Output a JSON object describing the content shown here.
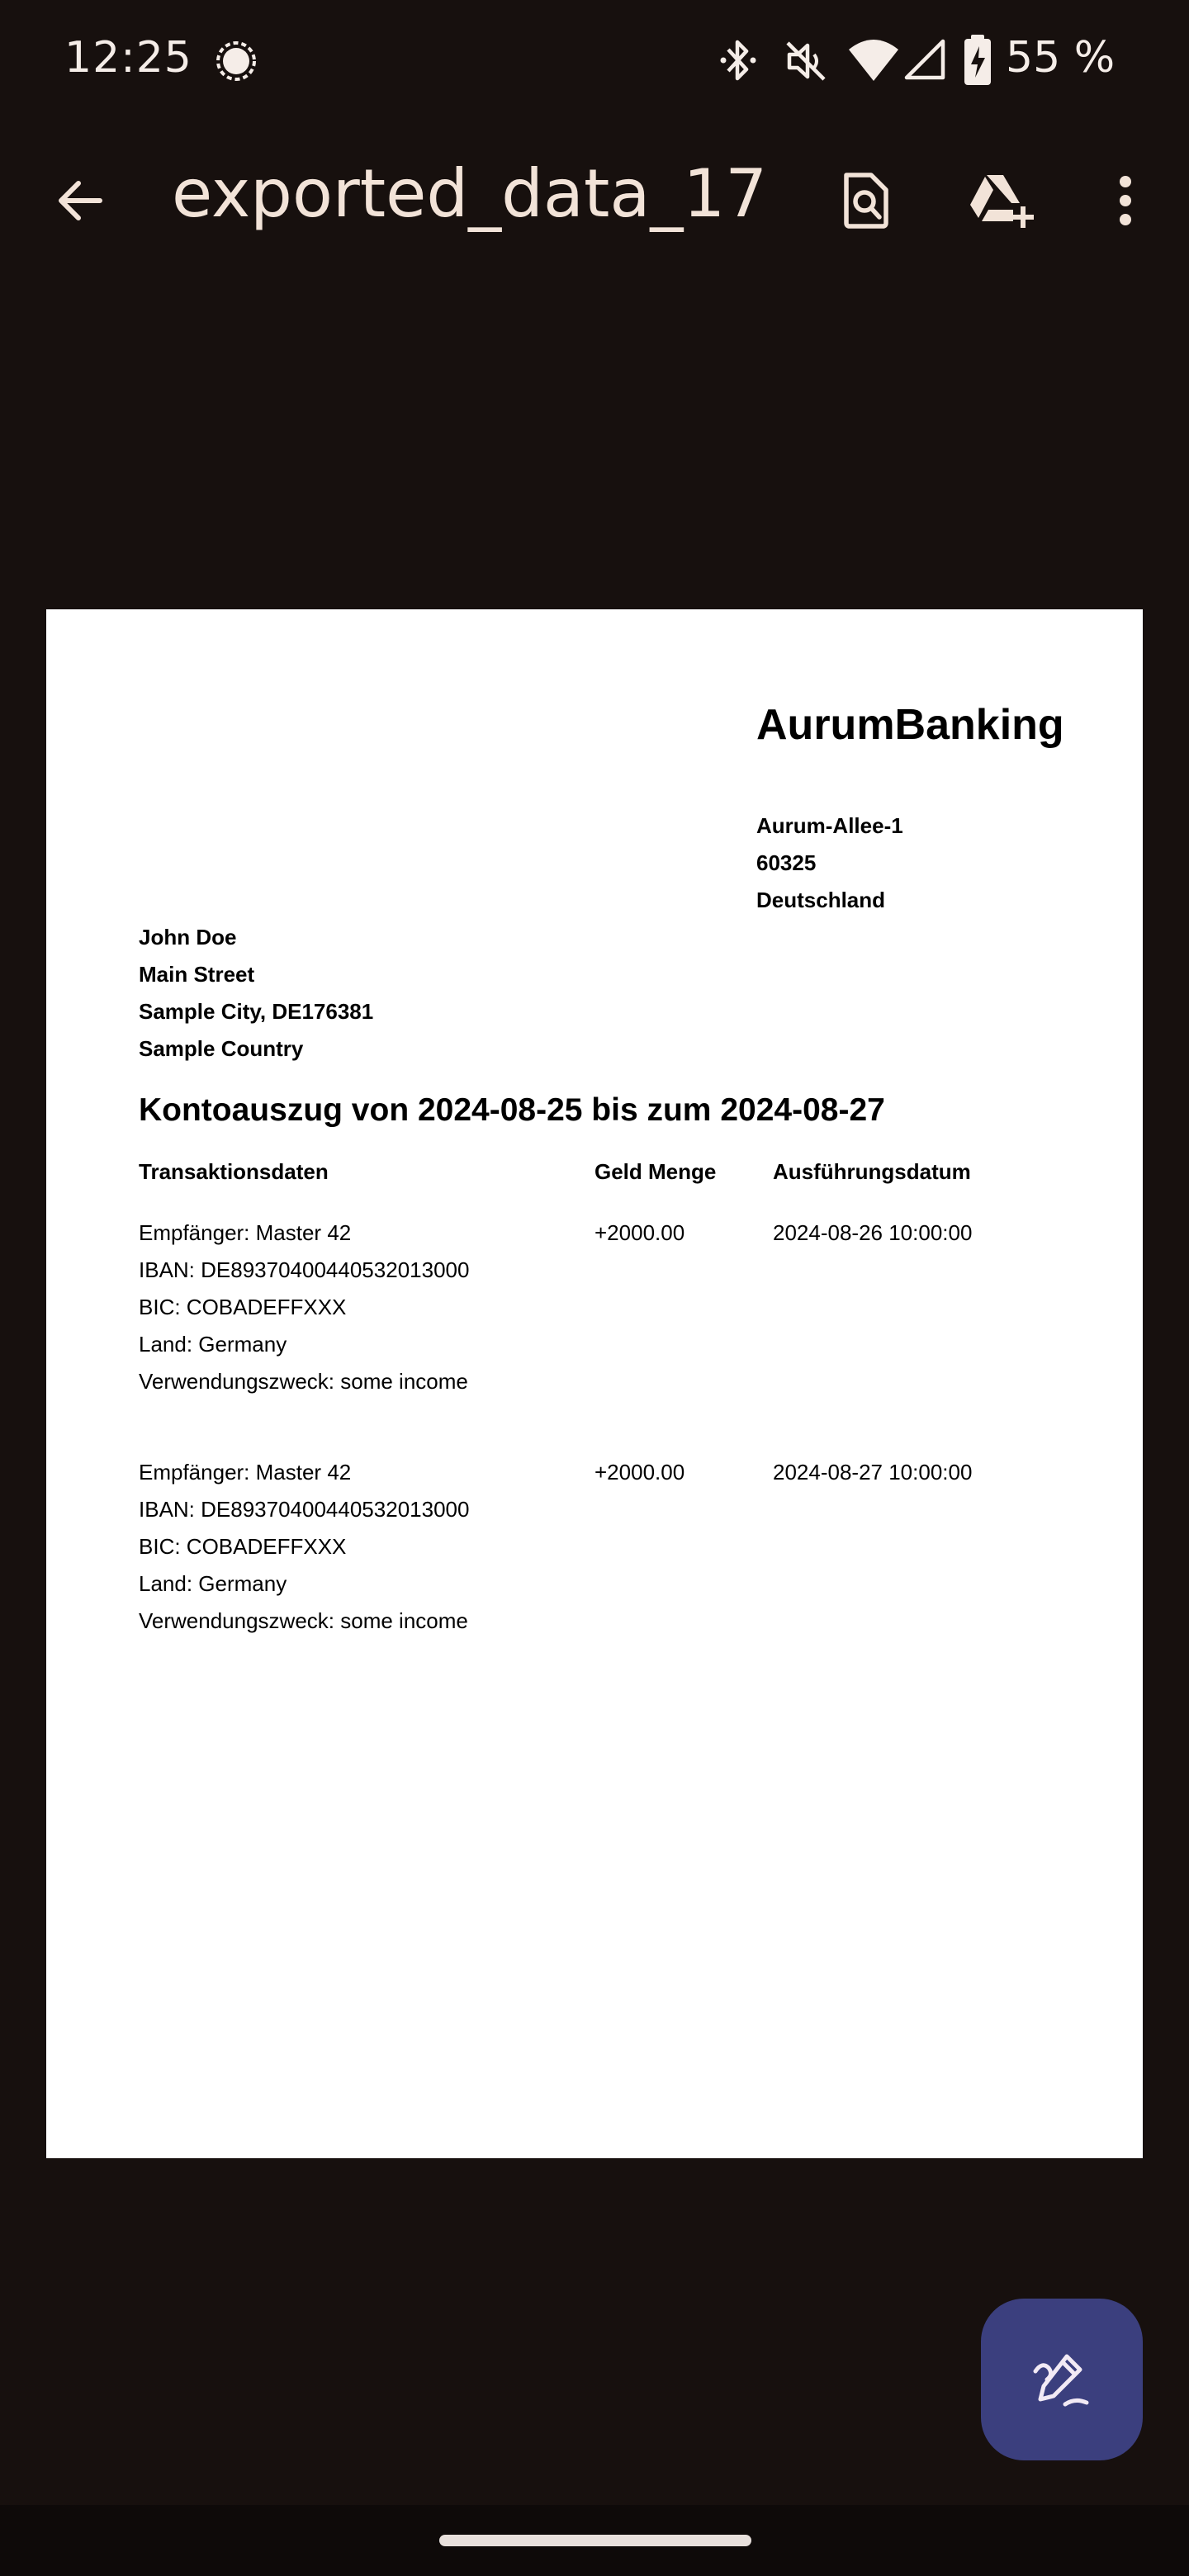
{
  "status_bar": {
    "time": "12:25",
    "battery": "55 %",
    "icons": [
      "signal-app-icon",
      "bluetooth-icon",
      "mute-icon",
      "wifi-icon",
      "cell-signal-icon",
      "battery-charging-icon"
    ]
  },
  "toolbar": {
    "title": "exported_data_17...",
    "actions": [
      "back-arrow-icon",
      "find-in-page-icon",
      "add-to-drive-icon",
      "more-vert-icon"
    ]
  },
  "document": {
    "bank": {
      "name": "AurumBanking",
      "street": "Aurum-Allee-1",
      "zip": "60325",
      "country": "Deutschland"
    },
    "customer": {
      "name": "John Doe",
      "street": "Main Street",
      "city": "Sample City, DE176381",
      "country": "Sample Country"
    },
    "title": "Kontoauszug von 2024-08-25 bis zum 2024-08-27",
    "columns": {
      "details": "Transaktionsdaten",
      "amount": "Geld Menge",
      "date": "Ausführungsdatum"
    },
    "transactions": [
      {
        "recipient": "Empfänger: Master 42",
        "iban": "IBAN: DE89370400440532013000",
        "bic": "BIC: COBADEFFXXX",
        "country": "Land: Germany",
        "purpose": "Verwendungszweck: some income",
        "amount": "+2000.00",
        "date": "2024-08-26 10:00:00"
      },
      {
        "recipient": "Empfänger: Master 42",
        "iban": "IBAN: DE89370400440532013000",
        "bic": "BIC: COBADEFFXXX",
        "country": "Land: Germany",
        "purpose": "Verwendungszweck: some income",
        "amount": "+2000.00",
        "date": "2024-08-27 10:00:00"
      }
    ]
  },
  "fab": {
    "icon": "edit-draw-icon"
  },
  "colors": {
    "background": "#17100e",
    "page": "#ffffff",
    "fab": "#3b3f7e",
    "toolbar_text": "#f2e3d8"
  }
}
